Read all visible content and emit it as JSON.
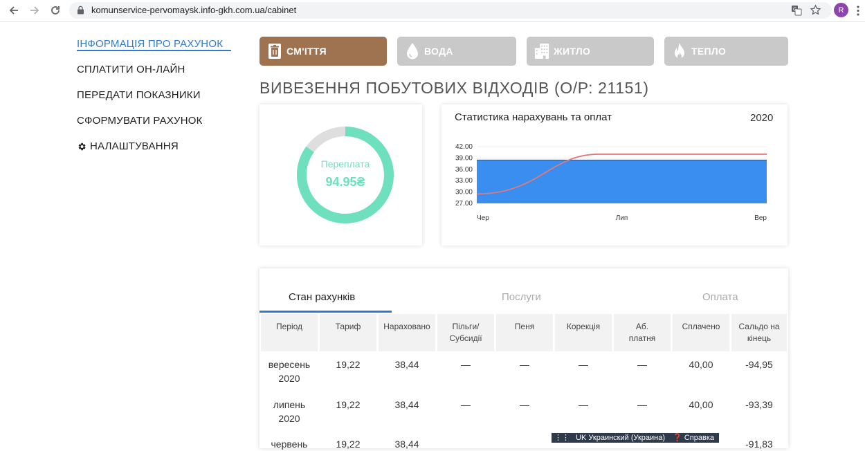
{
  "browser": {
    "url": "komunservice-pervomaysk.info-gkh.com.ua/cabinet",
    "profile_initial": "R"
  },
  "sidebar": {
    "items": [
      {
        "label": "ІНФОРМАЦІЯ ПРО РАХУНОК"
      },
      {
        "label": "СПЛАТИТИ ОН-ЛАЙН"
      },
      {
        "label": "ПЕРЕДАТИ ПОКАЗНИКИ"
      },
      {
        "label": "СФОРМУВАТИ РАХУНОК"
      },
      {
        "label": "НАЛАШТУВАННЯ",
        "icon": "gear-icon"
      }
    ]
  },
  "services": [
    {
      "label": "СМ'ІТТЯ",
      "icon": "trash-icon"
    },
    {
      "label": "ВОДА",
      "icon": "water-drop-icon"
    },
    {
      "label": "ЖИТЛО",
      "icon": "building-icon"
    },
    {
      "label": "ТЕПЛО",
      "icon": "flame-icon"
    }
  ],
  "colors": {
    "accent": "#2e7bcf",
    "service_active": "#a07350",
    "service_inactive": "#c9c9c9",
    "donut": "#6fe0bd",
    "bars": "#3a8ef0",
    "line": "#e07a7a"
  },
  "page_title": "ВИВЕЗЕННЯ ПОБУТОВИХ ВІДХОДІВ (О/Р: 21151)",
  "balance": {
    "label": "Переплата",
    "amount": "94.95₴",
    "fill_fraction": 0.85
  },
  "stats": {
    "title": "Статистика нарахувань та оплат",
    "year": "2020"
  },
  "chart_data": {
    "type": "area",
    "title": "Статистика нарахувань та оплат",
    "categories": [
      "Чер",
      "Лип",
      "Вер"
    ],
    "ytick_labels": [
      "42.00",
      "39.00",
      "36.00",
      "33.00",
      "30.00",
      "27.00"
    ],
    "ylim": [
      27,
      42
    ],
    "series": [
      {
        "kind": "area",
        "values": [
          38.44,
          38.44,
          38.44
        ]
      },
      {
        "kind": "line",
        "values": [
          29.5,
          40.0,
          40.0
        ]
      }
    ]
  },
  "table": {
    "tabs": [
      "Стан рахунків",
      "Послуги",
      "Оплата"
    ],
    "headers": [
      "Період",
      "Тариф",
      "Нараховано",
      "Пільги/ Субсидії",
      "Пеня",
      "Корекція",
      "Аб. платня",
      "Сплачено",
      "Сальдо на кінець"
    ],
    "rows": [
      [
        "вересень 2020",
        "19,22",
        "38,44",
        "—",
        "—",
        "—",
        "—",
        "40,00",
        "-94,95"
      ],
      [
        "липень 2020",
        "19,22",
        "38,44",
        "—",
        "—",
        "—",
        "—",
        "40,00",
        "-93,39"
      ]
    ],
    "partial_row": [
      "червень",
      "19,22",
      "38,44",
      "",
      "",
      "",
      "",
      "",
      "-91,83"
    ]
  },
  "taskbar": {
    "text": "UK Украинский (Украина)",
    "help": "Справка"
  }
}
